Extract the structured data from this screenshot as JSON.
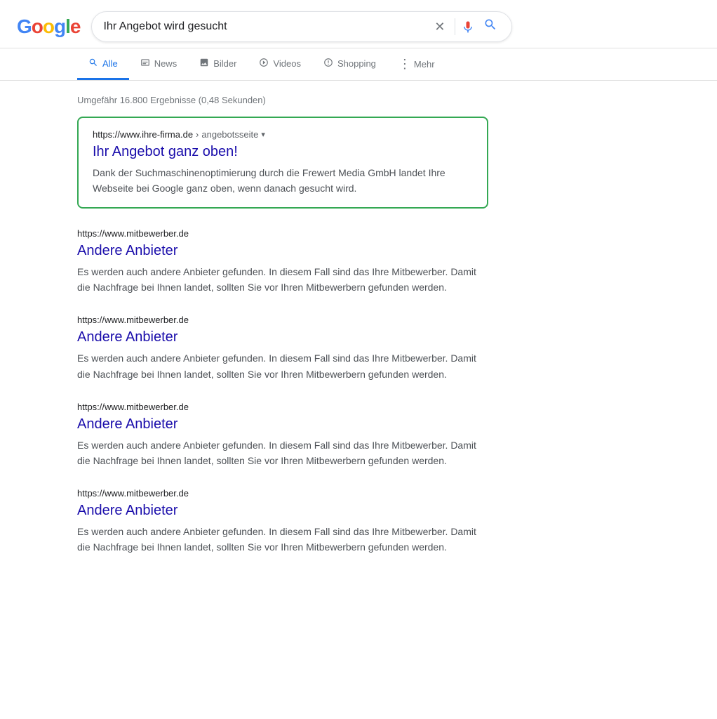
{
  "header": {
    "logo": "Google",
    "logo_letters": [
      "G",
      "o",
      "o",
      "g",
      "l",
      "e"
    ],
    "search_value": "Ihr Angebot wird gesucht",
    "clear_icon": "✕",
    "voice_search_label": "voice-search",
    "search_submit_label": "search"
  },
  "nav": {
    "tabs": [
      {
        "id": "all",
        "label": "Alle",
        "icon": "search",
        "active": true
      },
      {
        "id": "news",
        "label": "News",
        "icon": "news",
        "active": false
      },
      {
        "id": "images",
        "label": "Bilder",
        "icon": "images",
        "active": false
      },
      {
        "id": "videos",
        "label": "Videos",
        "icon": "videos",
        "active": false
      },
      {
        "id": "shopping",
        "label": "Shopping",
        "icon": "shopping",
        "active": false
      }
    ],
    "more_label": "Mehr"
  },
  "results": {
    "stats": "Umgefähr 16.800 Ergebnisse (0,48 Sekunden)",
    "items": [
      {
        "id": "featured",
        "url_domain": "https://www.ihre-firma.de",
        "url_breadcrumb": "angebotsseite",
        "title": "Ihr Angebot ganz oben!",
        "snippet": "Dank der Suchmaschinenoptimierung durch die Frewert Media GmbH landet Ihre Webseite bei Google ganz oben, wenn danach gesucht wird.",
        "featured": true
      },
      {
        "id": "competitor1",
        "url_domain": "https://www.mitbewerber.de",
        "url_breadcrumb": "",
        "title": "Andere Anbieter",
        "snippet": "Es werden auch andere Anbieter gefunden. In diesem Fall sind das Ihre Mitbewerber. Damit die Nachfrage bei Ihnen landet, sollten Sie vor Ihren Mitbewerbern gefunden werden.",
        "featured": false
      },
      {
        "id": "competitor2",
        "url_domain": "https://www.mitbewerber.de",
        "url_breadcrumb": "",
        "title": "Andere Anbieter",
        "snippet": "Es werden auch andere Anbieter gefunden. In diesem Fall sind das Ihre Mitbewerber. Damit die Nachfrage bei Ihnen landet, sollten Sie vor Ihren Mitbewerbern gefunden werden.",
        "featured": false
      },
      {
        "id": "competitor3",
        "url_domain": "https://www.mitbewerber.de",
        "url_breadcrumb": "",
        "title": "Andere Anbieter",
        "snippet": "Es werden auch andere Anbieter gefunden. In diesem Fall sind das Ihre Mitbewerber. Damit die Nachfrage bei Ihnen landet, sollten Sie vor Ihren Mitbewerbern gefunden werden.",
        "featured": false
      },
      {
        "id": "competitor4",
        "url_domain": "https://www.mitbewerber.de",
        "url_breadcrumb": "",
        "title": "Andere Anbieter",
        "snippet": "Es werden auch andere Anbieter gefunden. In diesem Fall sind das Ihre Mitbewerber. Damit die Nachfrage bei Ihnen landet, sollten Sie vor Ihren Mitbewerbern gefunden werden.",
        "featured": false
      }
    ]
  }
}
